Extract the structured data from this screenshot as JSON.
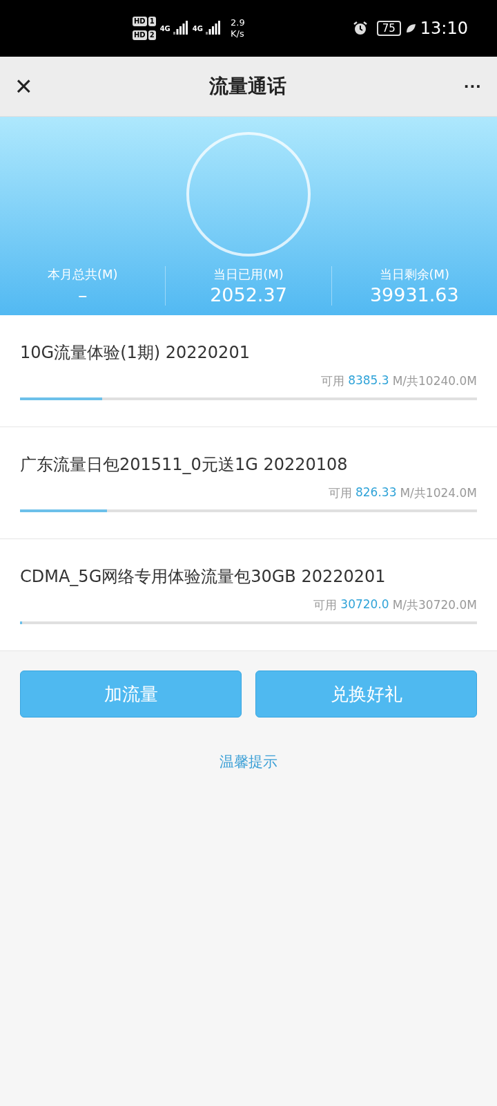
{
  "status_bar": {
    "sims": [
      {
        "badge": "HD",
        "slot": "1",
        "network": "4G"
      },
      {
        "badge": "HD",
        "slot": "2",
        "network": "4G"
      }
    ],
    "speed_value": "2.9",
    "speed_unit": "K/s",
    "battery": "75",
    "time": "13:10"
  },
  "header": {
    "close_icon": "×",
    "title": "流量通话",
    "more": "···"
  },
  "summary": {
    "stats": [
      {
        "label": "本月总共(M)",
        "value": "–"
      },
      {
        "label": "当日已用(M)",
        "value": "2052.37"
      },
      {
        "label": "当日剩余(M)",
        "value": "39931.63"
      }
    ]
  },
  "packages": [
    {
      "name": "10G流量体验(1期) 20220201",
      "available_label": "可用",
      "available": "8385.3",
      "total": "M/共10240.0M",
      "level": 0.18
    },
    {
      "name": "广东流量日包201511_0元送1G 20220108",
      "available_label": "可用",
      "available": "826.33",
      "total": "M/共1024.0M",
      "level": 0.19
    },
    {
      "name": "CDMA_5G网络专用体验流量包30GB 20220201",
      "available_label": "可用",
      "available": "30720.0",
      "total": "M/共30720.0M",
      "level": 0.005
    }
  ],
  "buttons": [
    "加流量",
    "兑换好礼"
  ],
  "tip_link": "温馨提示"
}
